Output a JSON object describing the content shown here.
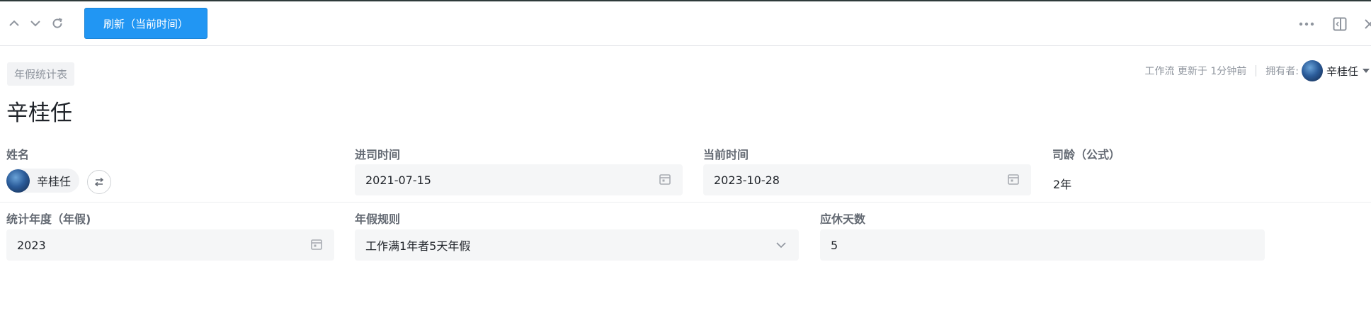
{
  "toolbar": {
    "refresh_label": "刷新（当前时间）",
    "icons": [
      "chevron-up-icon",
      "chevron-down-icon",
      "reload-icon",
      "more-icon",
      "sidebar-collapse-icon",
      "close-icon"
    ]
  },
  "header": {
    "tag": "年假统计表",
    "updated": "工作流 更新于 1分钟前",
    "owner_label": "拥有者:",
    "owner_name": "辛桂任"
  },
  "record": {
    "title": "辛桂任"
  },
  "fields": {
    "name": {
      "label": "姓名",
      "value": "辛桂任"
    },
    "join_date": {
      "label": "进司时间",
      "value": "2021-07-15"
    },
    "current_date": {
      "label": "当前时间",
      "value": "2023-10-28"
    },
    "tenure": {
      "label": "司龄（公式）",
      "value": "2年"
    },
    "stat_year": {
      "label": "统计年度（年假)",
      "value": "2023"
    },
    "leave_rule": {
      "label": "年假规则",
      "value": "工作满1年者5天年假"
    },
    "leave_days": {
      "label": "应休天数",
      "value": "5"
    }
  },
  "colors": {
    "accent": "#2196f3",
    "input_bg": "#f5f6f7",
    "label": "#646a73",
    "text": "#1f2329"
  }
}
